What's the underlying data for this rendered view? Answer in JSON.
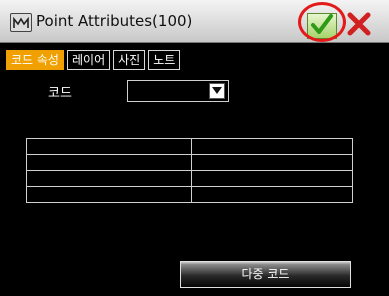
{
  "window": {
    "title": "Point Attributes(100)"
  },
  "tabs": [
    {
      "label": "코드 속성",
      "active": true
    },
    {
      "label": "레이어",
      "active": false
    },
    {
      "label": "사진",
      "active": false
    },
    {
      "label": "노트",
      "active": false
    }
  ],
  "code": {
    "label": "코드",
    "selected": ""
  },
  "table": {
    "rows": [
      [
        "",
        ""
      ],
      [
        "",
        ""
      ],
      [
        "",
        ""
      ],
      [
        "",
        ""
      ]
    ]
  },
  "buttons": {
    "multi_code": "다중 코드"
  },
  "icons": {
    "app": "app-icon",
    "ok": "check-icon",
    "close": "close-icon",
    "dropdown": "chevron-down-icon"
  },
  "colors": {
    "tab_active_bg": "#f0a000",
    "highlight_circle": "#e41a1a",
    "ok_check": "#2e9a18",
    "close_x": "#d02020",
    "background": "#000000"
  }
}
